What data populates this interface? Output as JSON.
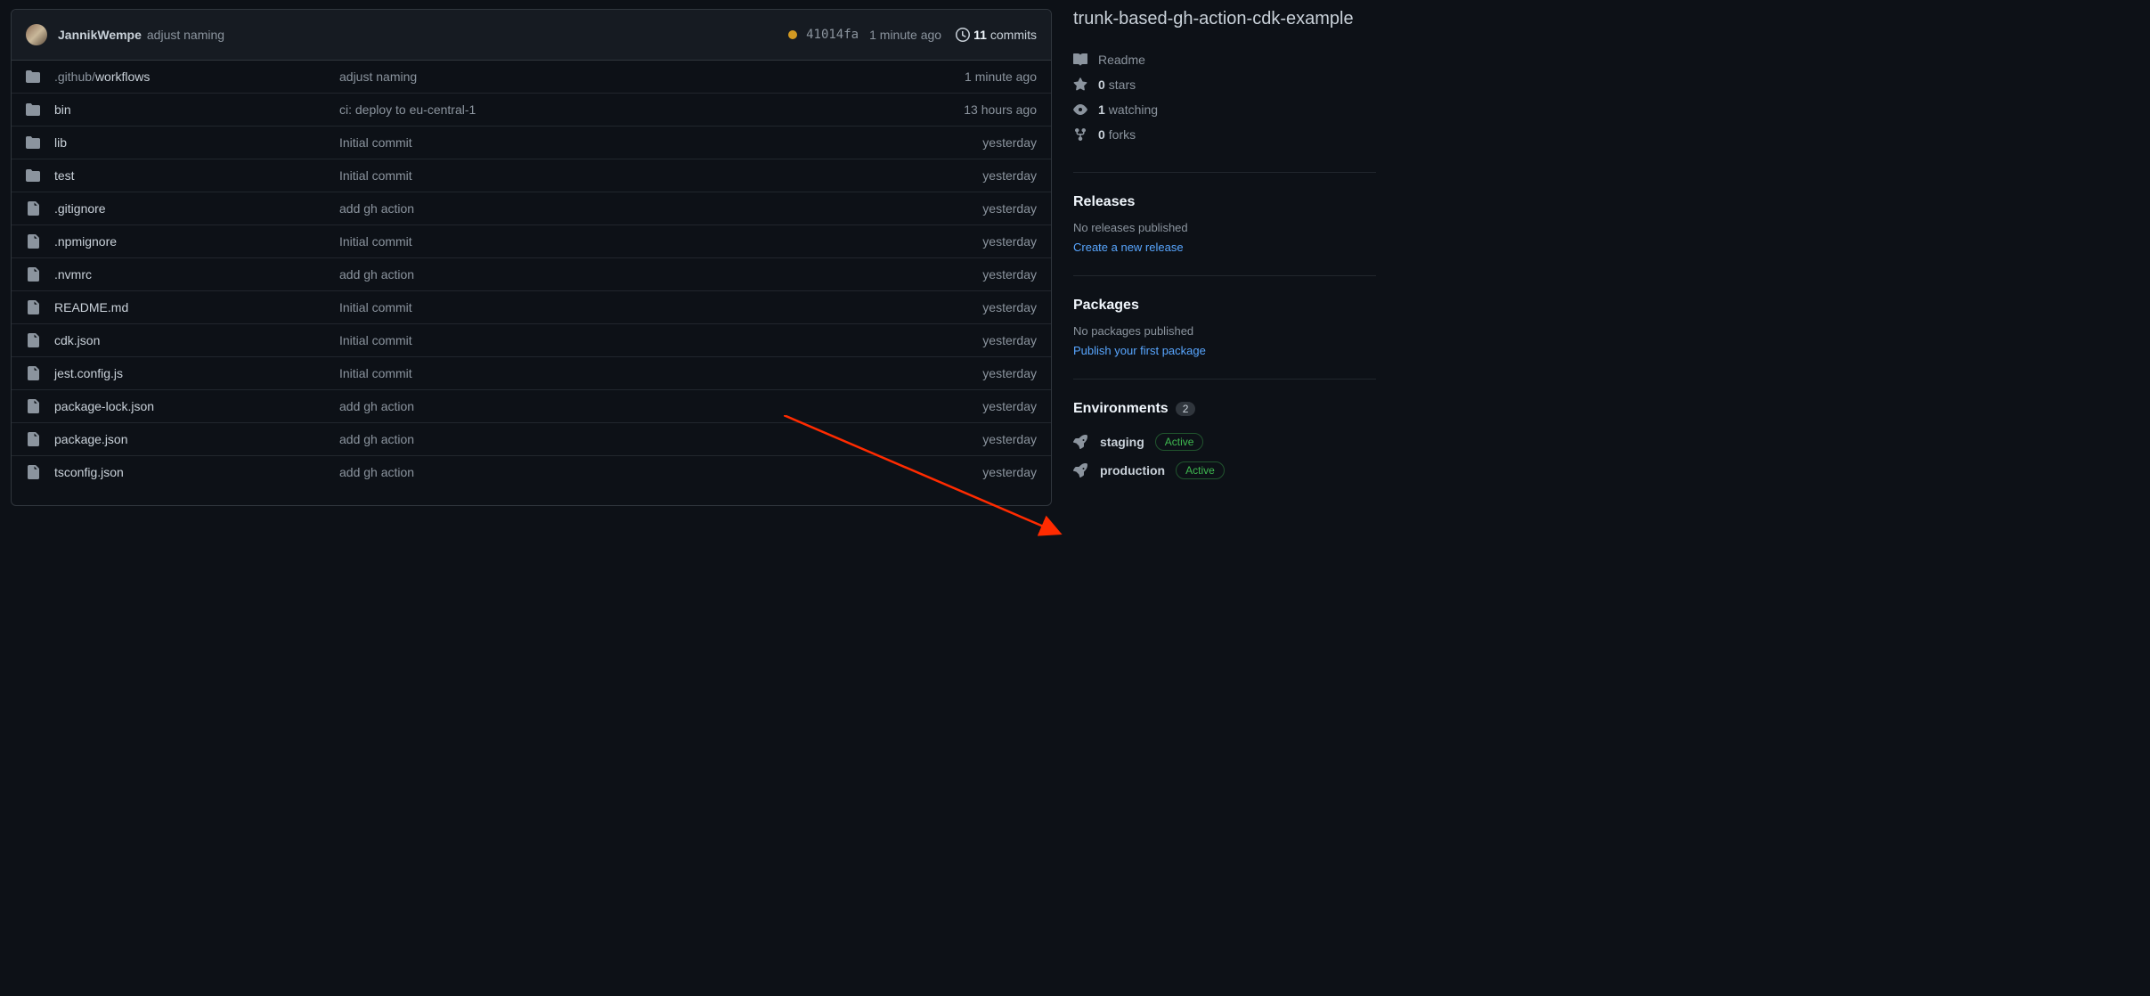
{
  "repo_name": "trunk-based-gh-action-cdk-example",
  "latest_commit": {
    "author": "JannikWempe",
    "message": "adjust naming",
    "sha": "41014fa",
    "time": "1 minute ago",
    "status": "pending",
    "commits_count": "11",
    "commits_label": "commits"
  },
  "files": [
    {
      "type": "dir",
      "name_prefix": ".github/",
      "name": "workflows",
      "msg": "adjust naming",
      "time": "1 minute ago"
    },
    {
      "type": "dir",
      "name_prefix": "",
      "name": "bin",
      "msg": "ci: deploy to eu-central-1",
      "time": "13 hours ago"
    },
    {
      "type": "dir",
      "name_prefix": "",
      "name": "lib",
      "msg": "Initial commit",
      "time": "yesterday"
    },
    {
      "type": "dir",
      "name_prefix": "",
      "name": "test",
      "msg": "Initial commit",
      "time": "yesterday"
    },
    {
      "type": "file",
      "name_prefix": "",
      "name": ".gitignore",
      "msg": "add gh action",
      "time": "yesterday"
    },
    {
      "type": "file",
      "name_prefix": "",
      "name": ".npmignore",
      "msg": "Initial commit",
      "time": "yesterday"
    },
    {
      "type": "file",
      "name_prefix": "",
      "name": ".nvmrc",
      "msg": "add gh action",
      "time": "yesterday"
    },
    {
      "type": "file",
      "name_prefix": "",
      "name": "README.md",
      "msg": "Initial commit",
      "time": "yesterday"
    },
    {
      "type": "file",
      "name_prefix": "",
      "name": "cdk.json",
      "msg": "Initial commit",
      "time": "yesterday"
    },
    {
      "type": "file",
      "name_prefix": "",
      "name": "jest.config.js",
      "msg": "Initial commit",
      "time": "yesterday"
    },
    {
      "type": "file",
      "name_prefix": "",
      "name": "package-lock.json",
      "msg": "add gh action",
      "time": "yesterday"
    },
    {
      "type": "file",
      "name_prefix": "",
      "name": "package.json",
      "msg": "add gh action",
      "time": "yesterday"
    },
    {
      "type": "file",
      "name_prefix": "",
      "name": "tsconfig.json",
      "msg": "add gh action",
      "time": "yesterday"
    }
  ],
  "about": {
    "readme": "Readme",
    "stars_count": "0",
    "stars_label": "stars",
    "watching_count": "1",
    "watching_label": "watching",
    "forks_count": "0",
    "forks_label": "forks"
  },
  "releases": {
    "title": "Releases",
    "empty": "No releases published",
    "cta": "Create a new release"
  },
  "packages": {
    "title": "Packages",
    "empty": "No packages published",
    "cta": "Publish your first package"
  },
  "environments": {
    "title": "Environments",
    "count": "2",
    "items": [
      {
        "name": "staging",
        "status": "Active"
      },
      {
        "name": "production",
        "status": "Active"
      }
    ]
  }
}
